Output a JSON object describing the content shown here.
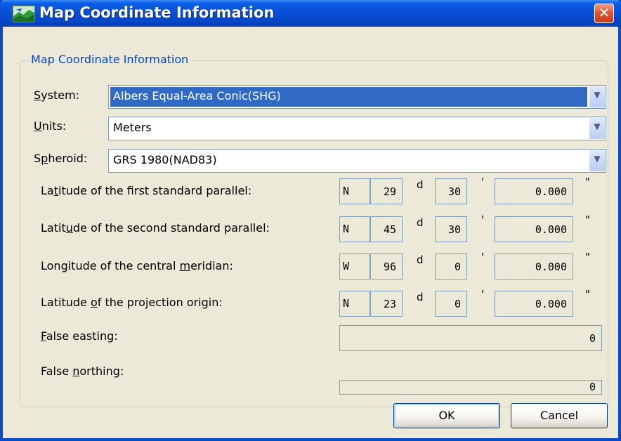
{
  "window": {
    "title": "Map Coordinate Information",
    "close_glyph": "✕"
  },
  "group": {
    "legend": "Map Coordinate Information"
  },
  "combos": {
    "system": {
      "label_pre": "",
      "label_ul": "S",
      "label_post": "ystem:",
      "value": "Albers Equal-Area Conic(SHG)"
    },
    "units": {
      "label_pre": "",
      "label_ul": "U",
      "label_post": "nits:",
      "value": "Meters"
    },
    "spheroid": {
      "label_pre": "S",
      "label_ul": "p",
      "label_post": "heroid:",
      "value": "GRS 1980(NAD83)"
    }
  },
  "params": [
    {
      "label_pre": "La",
      "label_ul": "t",
      "label_post": "itude of the first standard parallel:",
      "hemi": "N",
      "deg": "29",
      "min": "30",
      "sec": "0.000"
    },
    {
      "label_pre": "Latit",
      "label_ul": "u",
      "label_post": "de of the second standard parallel:",
      "hemi": "N",
      "deg": "45",
      "min": "30",
      "sec": "0.000"
    },
    {
      "label_pre": "Longitude of the central ",
      "label_ul": "m",
      "label_post": "eridian:",
      "hemi": "W",
      "deg": "96",
      "min": "0",
      "sec": "0.000"
    },
    {
      "label_pre": "Latitude ",
      "label_ul": "o",
      "label_post": "f the projection origin:",
      "hemi": "N",
      "deg": "23",
      "min": "0",
      "sec": "0.000"
    }
  ],
  "units_marks": {
    "deg": "d",
    "min": "'",
    "sec": "\""
  },
  "false_easting": {
    "label_pre": "",
    "label_ul": "F",
    "label_post": "alse easting:",
    "value": "0"
  },
  "false_northing": {
    "label_pre": "False ",
    "label_ul": "n",
    "label_post": "orthing:",
    "value": "0"
  },
  "buttons": {
    "ok": "OK",
    "cancel": "Cancel"
  },
  "icons": {
    "dropdown": "chevron-down-icon",
    "window": "map-icon",
    "close": "close-icon"
  },
  "colors": {
    "titlebar": "#0a4fd8",
    "selection": "#316ac5",
    "legend": "#0046d5",
    "close": "#e2572f"
  }
}
